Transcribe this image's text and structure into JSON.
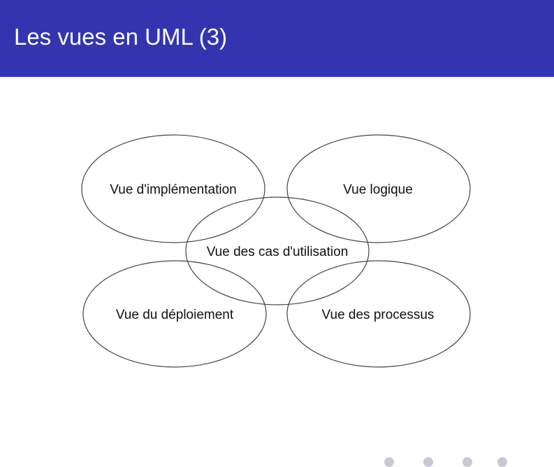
{
  "slide": {
    "title": "Les vues en UML (3)"
  },
  "diagram": {
    "views": {
      "implementation": "Vue d'implémentation",
      "logical": "Vue logique",
      "use_case": "Vue des cas d'utilisation",
      "deployment": "Vue du déploiement",
      "process": "Vue des processus"
    }
  },
  "colors": {
    "header_background": "#3434b0",
    "header_text": "#ffffff",
    "ellipse_stroke": "#444444",
    "label_text": "#111111"
  }
}
